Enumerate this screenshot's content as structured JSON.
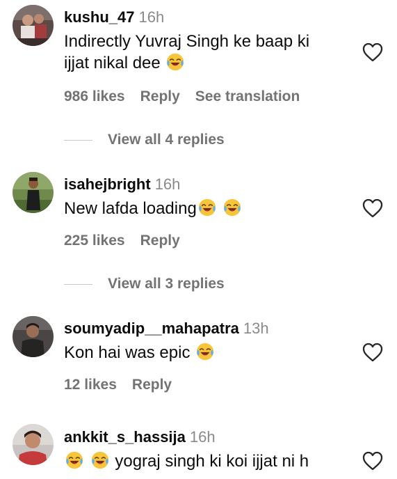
{
  "comments": [
    {
      "username": "kushu_47",
      "time": "16h",
      "text_line1": "Indirectly Yuvraj Singh ke baap ki",
      "text_line2": "ijjat nikal dee",
      "likes": "986 likes",
      "reply": "Reply",
      "see_translation": "See translation",
      "view_replies": "View all 4 replies"
    },
    {
      "username": "isahejbright",
      "time": "16h",
      "text": "New lafda loading",
      "likes": "225 likes",
      "reply": "Reply",
      "view_replies": "View all 3 replies"
    },
    {
      "username": "soumyadip__mahapatra",
      "time": "13h",
      "text": "Kon hai was epic",
      "likes": "12 likes",
      "reply": "Reply"
    },
    {
      "username": "ankkit_s_hassija",
      "time": "16h",
      "text": "yograj singh ki koi ijjat ni h"
    }
  ],
  "icons": {
    "like": "heart-outline-icon",
    "emoji": "face-with-tears-of-joy-emoji"
  },
  "colors": {
    "primary_text": "#0c0c0c",
    "secondary_text": "#737373",
    "timestamp": "#8a8a8a",
    "divider": "#c7c7c7",
    "emoji_yellow": "#f7c53a"
  }
}
